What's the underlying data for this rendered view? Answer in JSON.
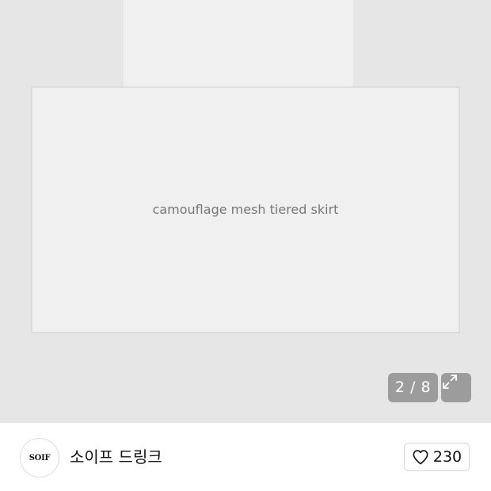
{
  "gallery": {
    "image_label": "camouflage mesh tiered skirt",
    "counter_current": "2",
    "counter_total": "8",
    "counter_text": "2 / 8",
    "expand_icon": "expand-icon"
  },
  "seller": {
    "avatar_text": "SOIF",
    "name": "소이프 드링크"
  },
  "like": {
    "icon": "heart-icon",
    "count": "230"
  }
}
